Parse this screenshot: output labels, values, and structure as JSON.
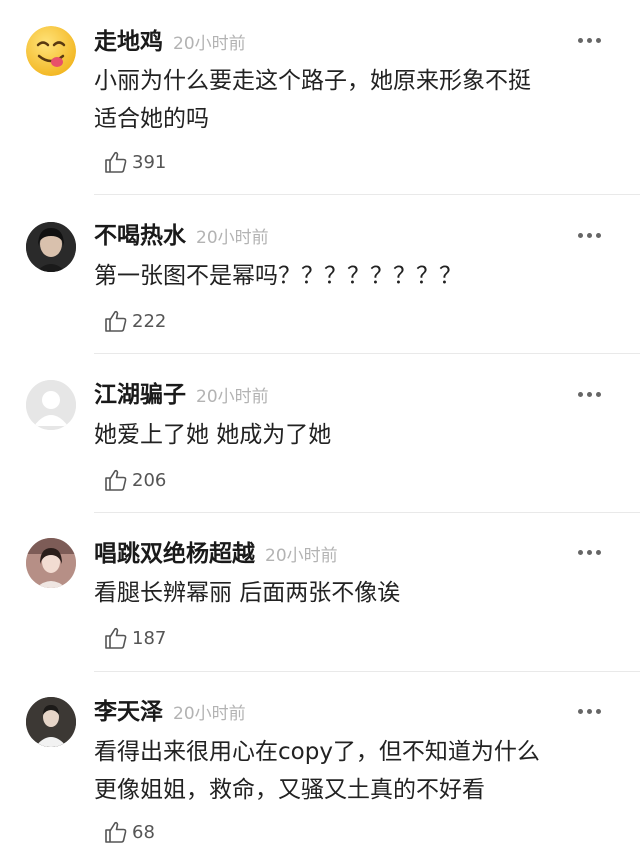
{
  "comments": [
    {
      "username": "走地鸡",
      "time": "20小时前",
      "lines": [
        "小丽为什么要走这个路子，她原来形象不挺",
        "适合她的吗"
      ],
      "likes": "391",
      "avatar": "emoji-yum-face"
    },
    {
      "username": "不喝热水",
      "time": "20小时前",
      "lines": [
        "第一张图不是幂吗？？？？？？？？"
      ],
      "likes": "222",
      "avatar": "photo-girl"
    },
    {
      "username": "江湖骗子",
      "time": "20小时前",
      "lines": [
        "她爱上了她 她成为了她"
      ],
      "likes": "206",
      "avatar": "default-person"
    },
    {
      "username": "唱跳双绝杨超越",
      "time": "20小时前",
      "lines": [
        "看腿长辨幂丽 后面两张不像诶"
      ],
      "likes": "187",
      "avatar": "photo-girl-stage"
    },
    {
      "username": "李天泽",
      "time": "20小时前",
      "lines": [
        "看得出来很用心在copy了，但不知道为什么",
        "更像姐姐，救命，又骚又土真的不好看"
      ],
      "likes": "68",
      "avatar": "photo-person-dark"
    }
  ]
}
